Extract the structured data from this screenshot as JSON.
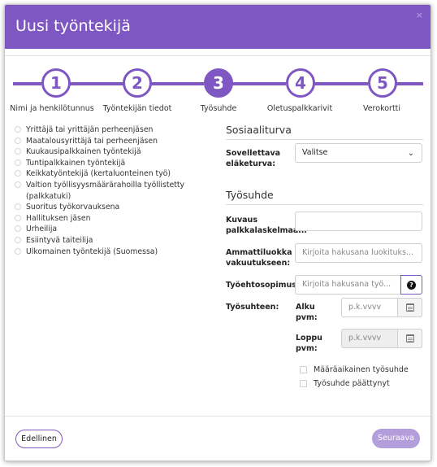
{
  "dialog": {
    "title": "Uusi työntekijä",
    "close_label": "×"
  },
  "steps": [
    {
      "number": "1",
      "label": "Nimi ja henkilötunnus"
    },
    {
      "number": "2",
      "label": "Työntekijän tiedot"
    },
    {
      "number": "3",
      "label": "Työsuhde"
    },
    {
      "number": "4",
      "label": "Oletuspalkkarivit"
    },
    {
      "number": "5",
      "label": "Verokortti"
    }
  ],
  "active_step": 3,
  "employee_types": [
    "Yrittäjä tai yrittäjän perheenjäsen",
    "Maatalousyrittäjä tai perheenjäsen",
    "Kuukausipalkkainen työntekijä",
    "Tuntipalkkainen työntekijä",
    "Keikkatyöntekijä (kertaluonteinen työ)",
    "Valtion työllisyysmäärärahoilla työllistetty (palkkatuki)",
    "Suoritus työkorvauksena",
    "Hallituksen jäsen",
    "Urheilija",
    "Esiintyvä taiteilija",
    "Ulkomainen työntekijä (Suomessa)"
  ],
  "social_security": {
    "title": "Sosiaaliturva",
    "pension_label": "Sovellettava eläketurva:",
    "pension_value": "Valitse"
  },
  "employment": {
    "title": "Työsuhde",
    "payroll_label": "Kuvaus palkkalaskelmaan:",
    "payroll_value": "",
    "occupation_label": "Ammattiluokka vakuutukseen:",
    "occupation_placeholder": "Kirjoita hakusana luokituks...",
    "agreement_label": "Työehtosopimus:",
    "agreement_placeholder": "Kirjoita hakusana työ...",
    "help_label": "?",
    "period_label": "Työsuhteen:",
    "start_label": "Alku pvm:",
    "start_placeholder": "p.k.vvvv",
    "end_label": "Loppu pvm:",
    "end_placeholder": "p.k.vvvv",
    "fixed_term_label": "Määräaikainen työsuhde",
    "ended_label": "Työsuhde päättynyt"
  },
  "footer": {
    "prev_label": "Edellinen",
    "next_label": "Seuraava"
  },
  "colors": {
    "accent": "#7e57c2",
    "accent_light": "#b39ddb"
  }
}
